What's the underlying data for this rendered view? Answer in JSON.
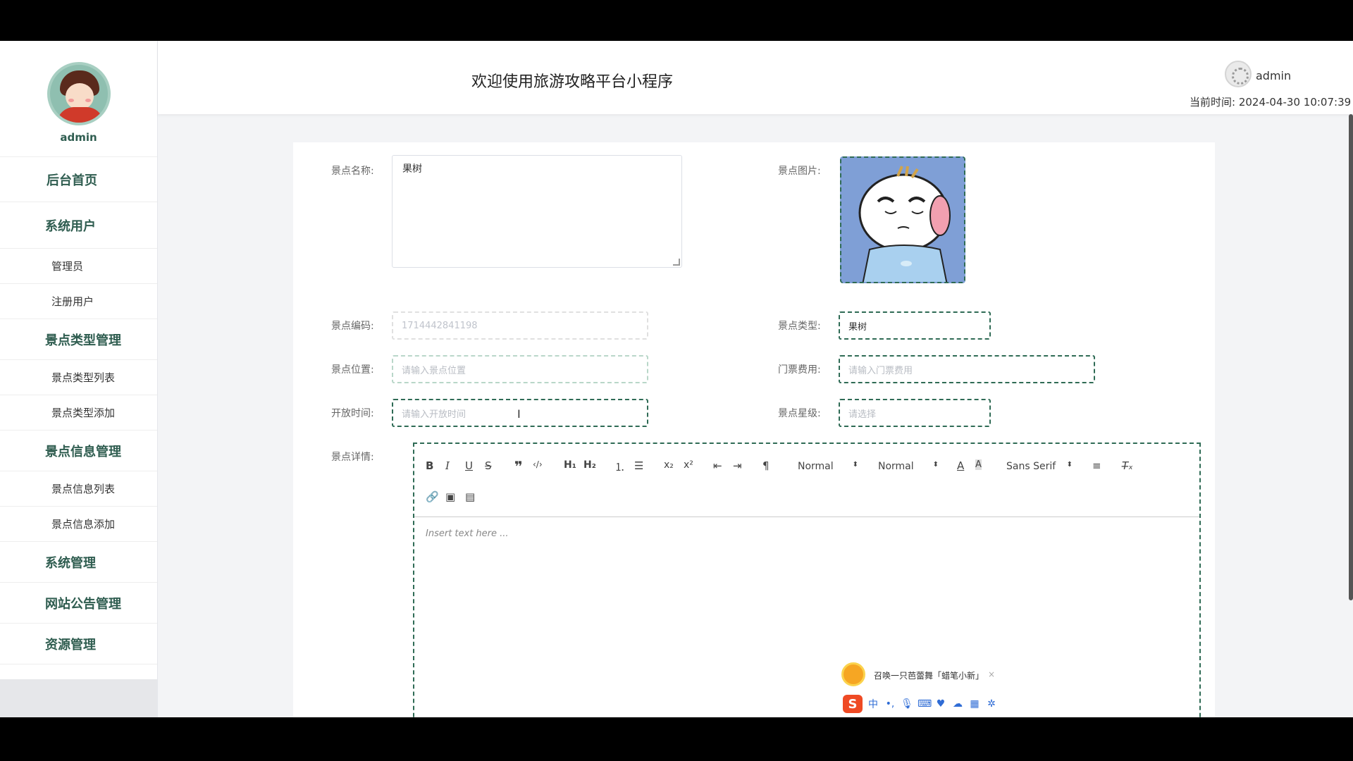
{
  "header": {
    "title": "欢迎使用旅游攻略平台小程序",
    "user": "admin",
    "time_label": "当前时间:",
    "time_value": "2024-04-30 10:07:39"
  },
  "sidebar": {
    "profile_name": "admin",
    "items": [
      {
        "label": "后台首页",
        "type": "top"
      },
      {
        "label": "系统用户",
        "type": "group"
      },
      {
        "label": "管理员",
        "type": "sub"
      },
      {
        "label": "注册用户",
        "type": "sub"
      },
      {
        "label": "景点类型管理",
        "type": "group"
      },
      {
        "label": "景点类型列表",
        "type": "sub"
      },
      {
        "label": "景点类型添加",
        "type": "sub"
      },
      {
        "label": "景点信息管理",
        "type": "group"
      },
      {
        "label": "景点信息列表",
        "type": "sub"
      },
      {
        "label": "景点信息添加",
        "type": "sub"
      },
      {
        "label": "系统管理",
        "type": "top"
      },
      {
        "label": "网站公告管理",
        "type": "top"
      },
      {
        "label": "资源管理",
        "type": "top"
      }
    ]
  },
  "form": {
    "name_label": "景点名称:",
    "name_value": "果树",
    "image_label": "景点图片:",
    "code_label": "景点编码:",
    "code_value": "1714442841198",
    "type_label": "景点类型:",
    "type_value": "果树",
    "location_label": "景点位置:",
    "location_placeholder": "请输入景点位置",
    "fee_label": "门票费用:",
    "fee_placeholder": "请输入门票费用",
    "opentime_label": "开放时间:",
    "opentime_placeholder": "请输入开放时间",
    "star_label": "景点星级:",
    "star_placeholder": "请选择",
    "detail_label": "景点详情:"
  },
  "editor": {
    "header_select": "Normal",
    "size_select": "Normal",
    "font_select": "Sans Serif",
    "placeholder": "Insert text here ..."
  },
  "ime": {
    "bubble_text": "召唤一只芭蕾舞「蜡笔小新」",
    "close": "×",
    "logo": "S",
    "mode": "中"
  },
  "colors": {
    "accent": "#2f6b55",
    "menu_text": "#2f5d50"
  }
}
